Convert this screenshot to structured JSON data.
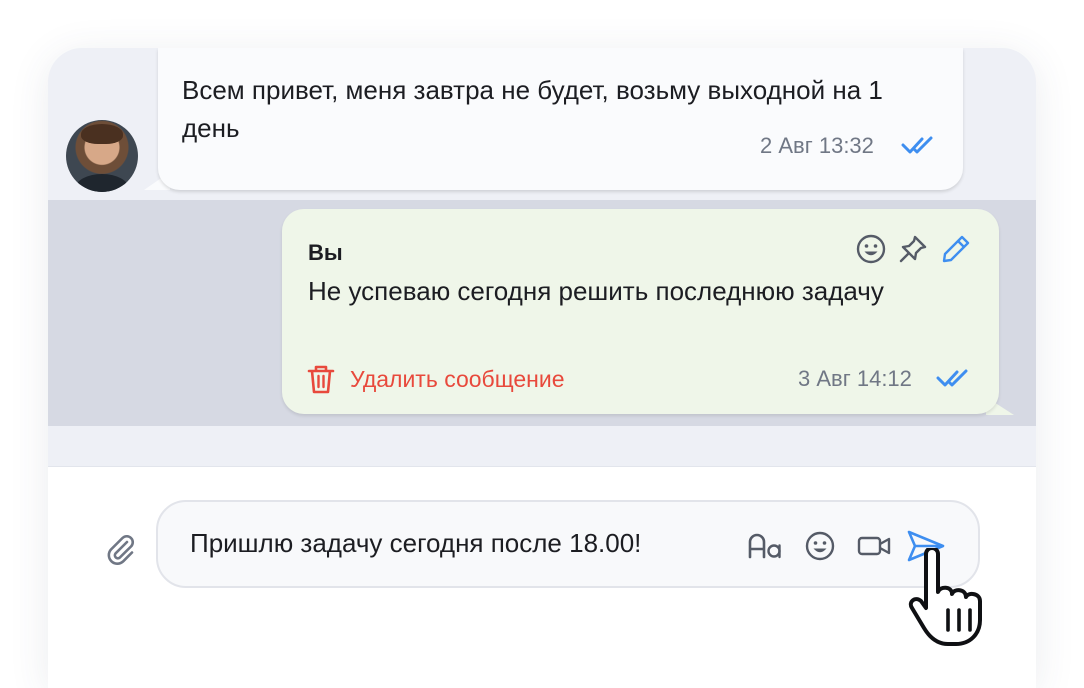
{
  "incoming_message": {
    "text": "Всем привет, меня завтра не будет, возьму выходной на 1 день",
    "timestamp": "2 Авг 13:32",
    "status": "read"
  },
  "outgoing_message": {
    "sender": "Вы",
    "text": "Не успеваю сегодня решить последнюю задачу",
    "timestamp": "3 Авг 14:12",
    "status": "read",
    "actions": [
      "emoji-icon",
      "pin-icon",
      "edit-icon"
    ],
    "delete_label": "Удалить сообщение"
  },
  "composer": {
    "value": "Пришлю задачу сегодня после 18.00!",
    "tools": [
      "attach-icon",
      "text-format-icon",
      "emoji-icon",
      "video-icon",
      "send-icon"
    ]
  },
  "colors": {
    "accent": "#3e8ef0",
    "danger": "#e8493c",
    "outgoing_bg": "#eff6e9",
    "selected_bg": "#d6d9e3"
  }
}
